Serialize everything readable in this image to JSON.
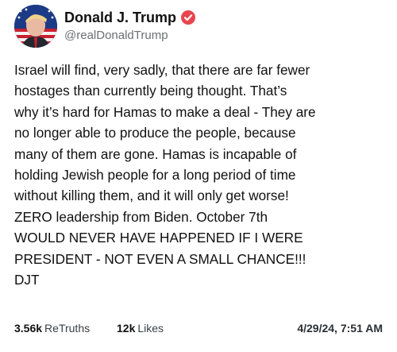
{
  "post": {
    "author": {
      "display_name": "Donald J. Trump",
      "handle": "@realDonaldTrump",
      "verified": true,
      "avatar_icon": "flag-portrait-avatar"
    },
    "body_lines": [
      "Israel will find, very sadly, that there are far fewer",
      "hostages than currently being thought. That’s",
      "why it’s hard for Hamas to make a deal - They are",
      "no longer able to produce the people, because",
      "many of them are gone. Hamas is incapable of",
      "holding Jewish people for a long period of time",
      "without killing them, and it will only get worse!",
      "ZERO leadership from Biden. October 7th",
      "WOULD NEVER HAVE HAPPENED IF I WERE",
      "PRESIDENT - NOT EVEN A SMALL CHANCE!!!",
      "DJT"
    ],
    "stats": {
      "retruths_count": "3.56k",
      "retruths_label": "ReTruths",
      "likes_count": "12k",
      "likes_label": "Likes"
    },
    "timestamp": "4/29/24, 7:51 AM"
  },
  "colors": {
    "verified_badge": "#e8454f",
    "text": "#111111",
    "handle": "#6b6f76"
  }
}
